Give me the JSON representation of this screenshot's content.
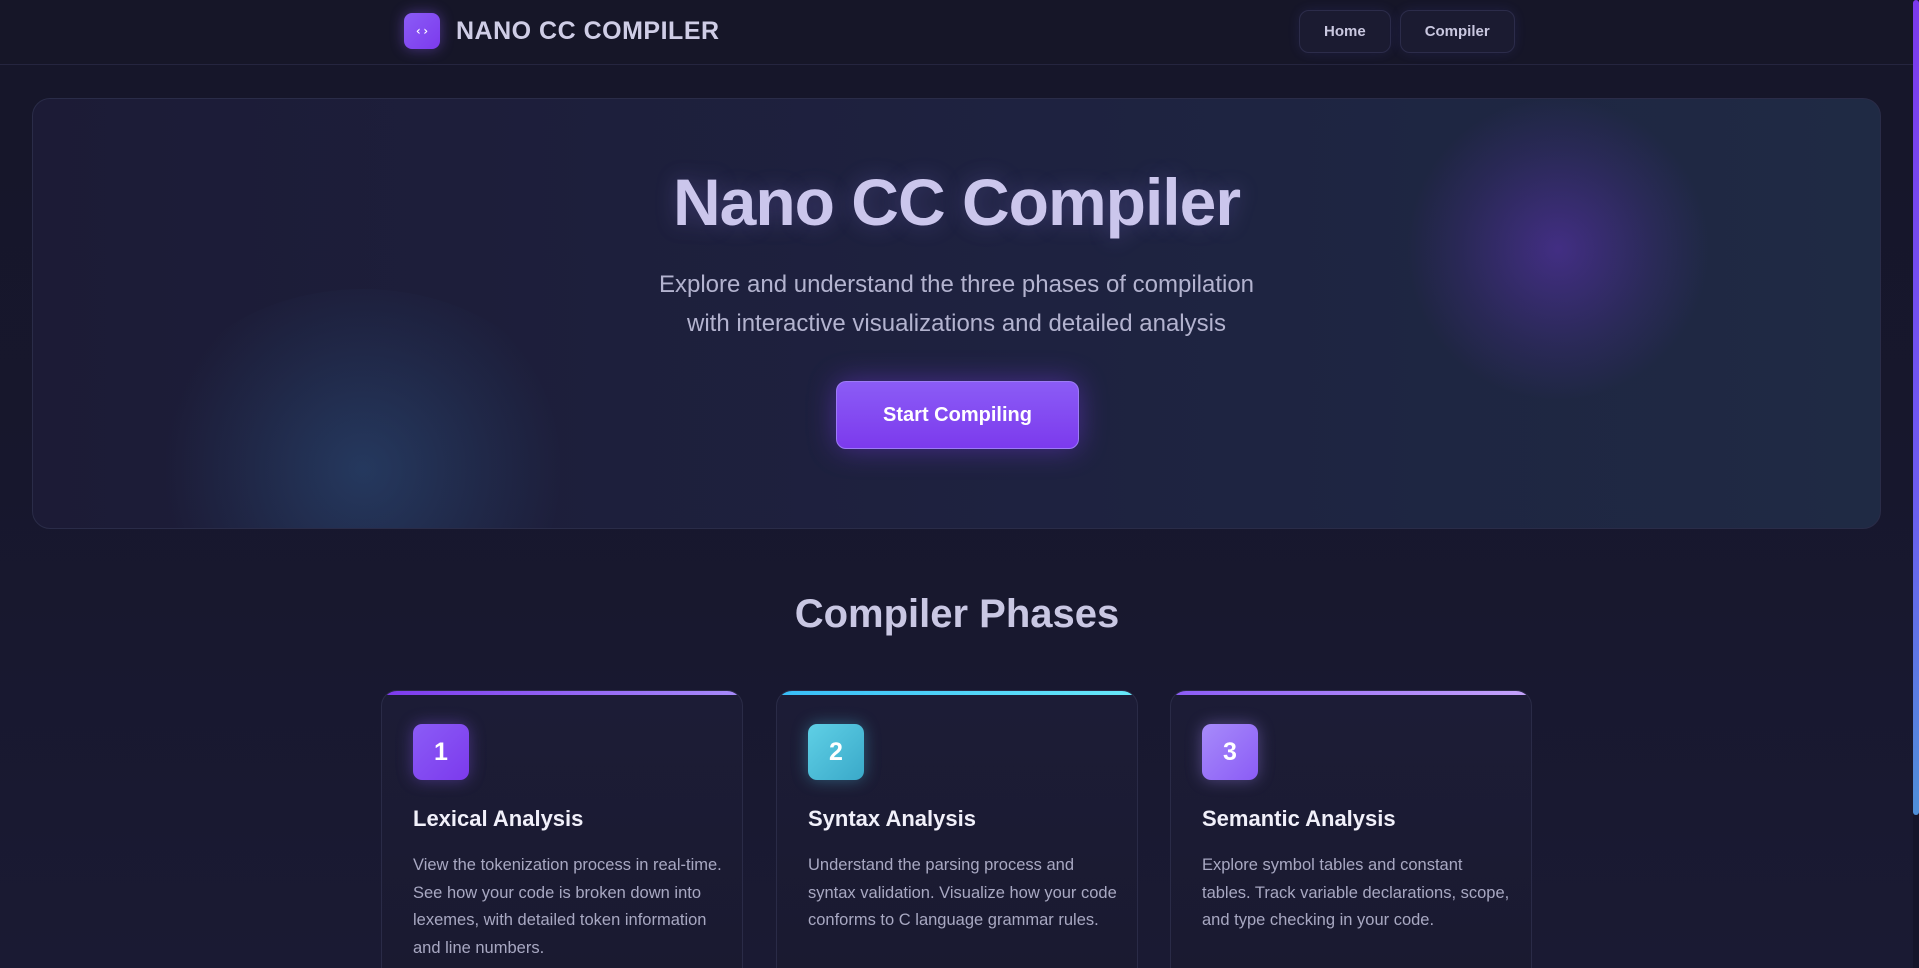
{
  "nav": {
    "brand_icon": "code-brackets-icon",
    "brand_icon_glyph": "‹›",
    "brand_name": "NANO CC COMPILER",
    "links": [
      "Home",
      "Compiler"
    ]
  },
  "hero": {
    "title": "Nano CC Compiler",
    "subtitle_line1": "Explore and understand the three phases of compilation",
    "subtitle_line2": "with interactive visualizations and detailed analysis",
    "cta": "Start Compiling"
  },
  "phases": {
    "title": "Compiler Phases",
    "cards": [
      {
        "number": "1",
        "title": "Lexical Analysis",
        "description": "View the tokenization process in real-time. See how your code is broken down into lexemes, with detailed token information and line numbers.",
        "accent": "#8b5cf6"
      },
      {
        "number": "2",
        "title": "Syntax Analysis",
        "description": "Understand the parsing process and syntax validation. Visualize how your code conforms to C language grammar rules.",
        "accent": "#4fc3dc"
      },
      {
        "number": "3",
        "title": "Semantic Analysis",
        "description": "Explore symbol tables and constant tables. Track variable declarations, scope, and type checking in your code.",
        "accent": "#9b6cf3"
      }
    ]
  },
  "colors": {
    "accent": "#7c3aed",
    "background": "#161629"
  }
}
